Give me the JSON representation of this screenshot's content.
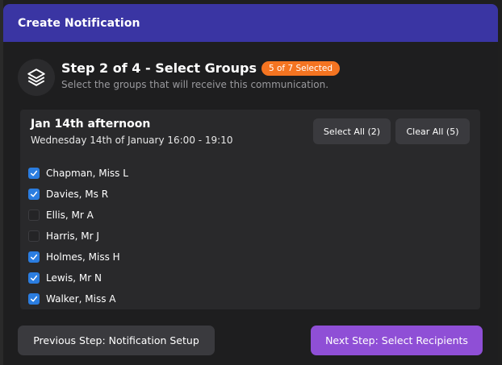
{
  "modal": {
    "title": "Create Notification"
  },
  "step": {
    "title": "Step 2 of 4 - Select Groups",
    "badge": "5 of 7 Selected",
    "subtitle": "Select the groups that will receive this communication."
  },
  "group": {
    "title": "Jan 14th afternoon",
    "date": "Wednesday 14th of January 16:00 - 19:10",
    "select_all_label": "Select All (2)",
    "clear_all_label": "Clear All (5)",
    "members": [
      {
        "name": "Chapman, Miss L",
        "checked": true
      },
      {
        "name": "Davies, Ms R",
        "checked": true
      },
      {
        "name": "Ellis, Mr A",
        "checked": false
      },
      {
        "name": "Harris, Mr J",
        "checked": false
      },
      {
        "name": "Holmes, Miss H",
        "checked": true
      },
      {
        "name": "Lewis, Mr N",
        "checked": true
      },
      {
        "name": "Walker, Miss A",
        "checked": true
      }
    ]
  },
  "footer": {
    "prev_label": "Previous Step: Notification Setup",
    "next_label": "Next Step: Select Recipients"
  },
  "colors": {
    "header": "#3a35a3",
    "badge": "#f47421",
    "checkbox": "#2b7de0",
    "next_button": "#8f4fd6"
  },
  "icons": {
    "step": "layers-icon",
    "check": "checkmark-icon"
  }
}
